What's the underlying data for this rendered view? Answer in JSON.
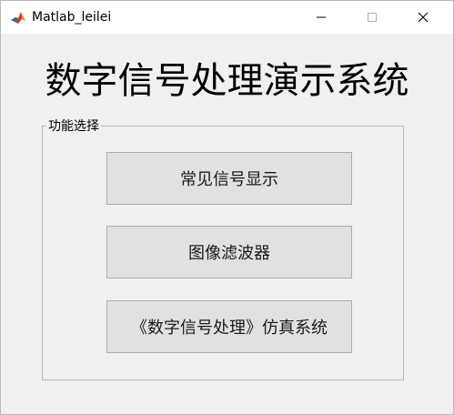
{
  "window": {
    "title": "Matlab_leilei",
    "icon": "matlab-icon",
    "controls": {
      "minimize_icon": "minimize-icon",
      "maximize_icon": "maximize-icon",
      "close_icon": "close-icon"
    }
  },
  "main": {
    "title": "数字信号处理演示系统",
    "group": {
      "label": "功能选择",
      "buttons": [
        {
          "label": "常见信号显示"
        },
        {
          "label": "图像滤波器"
        },
        {
          "label": "《数字信号处理》仿真系统"
        }
      ]
    }
  },
  "colors": {
    "background": "#f0f0f0",
    "titlebar": "#ffffff",
    "button_face": "#e1e1e1",
    "button_border": "#adadad",
    "frame_border": "#b9b9b9"
  }
}
